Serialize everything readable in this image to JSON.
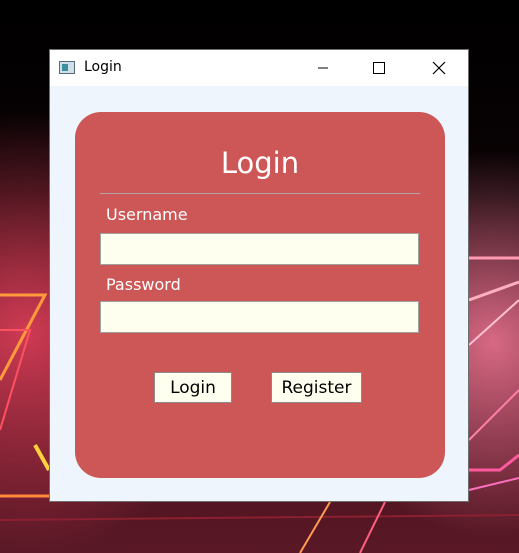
{
  "window": {
    "title": "Login"
  },
  "form": {
    "heading": "Login",
    "username_label": "Username",
    "username_value": "",
    "password_label": "Password",
    "password_value": "",
    "login_button": "Login",
    "register_button": "Register"
  },
  "colors": {
    "card_background": "#cd5656",
    "input_background": "#fffff0",
    "window_background": "#eef5fc"
  },
  "icons": {
    "app": "app-window-icon",
    "minimize": "minimize-icon",
    "maximize": "maximize-icon",
    "close": "close-icon"
  }
}
